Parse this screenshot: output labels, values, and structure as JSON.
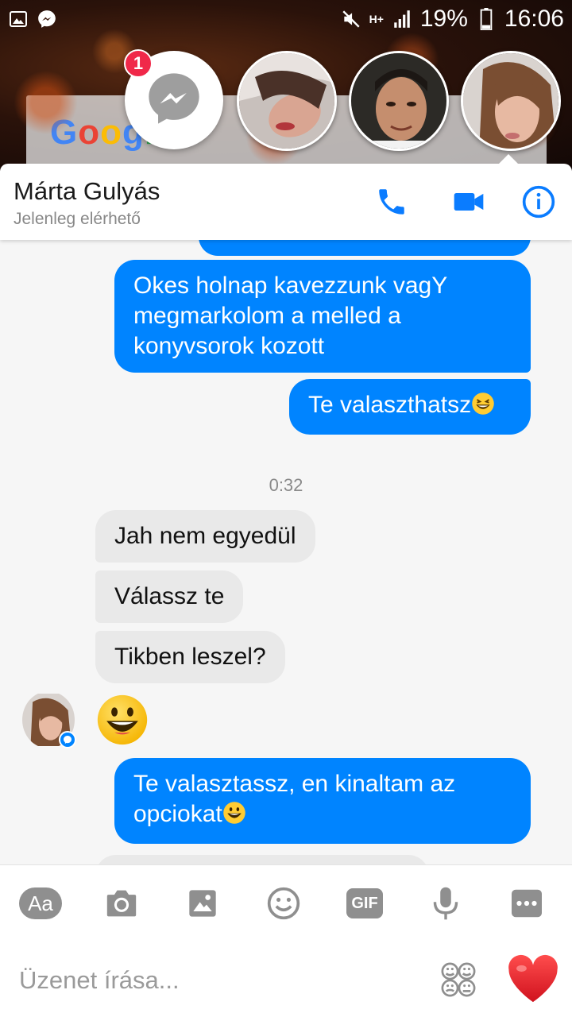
{
  "status_bar": {
    "battery": "19%",
    "time": "16:06",
    "network": "H+"
  },
  "wallpaper": {
    "google_logo": "Google"
  },
  "chat_heads": {
    "messenger_badge": "1"
  },
  "header": {
    "contact_name": "Márta Gulyás",
    "contact_status": "Jelenleg elérhető"
  },
  "messages": [
    {
      "direction": "out",
      "text": "Okes holnap kavezzunk vagY megmarkolom a melled a konyvsorok kozott"
    },
    {
      "direction": "out",
      "text": "Te valaszthatsz",
      "emoji": "grinning-squint-emoji"
    },
    {
      "type": "timestamp",
      "text": "0:32"
    },
    {
      "direction": "in",
      "text": "Jah nem egyedül"
    },
    {
      "direction": "in",
      "text": "Válassz te"
    },
    {
      "direction": "in",
      "text": "Tikben leszel?"
    },
    {
      "direction": "in",
      "emoji": "grinning-emoji"
    },
    {
      "direction": "out",
      "text": "Te valasztassz, en kinaltam az opciokat",
      "emoji": "grinning-emoji"
    }
  ],
  "toolbar": {
    "text_label": "Aa",
    "gif_label": "GIF"
  },
  "composer": {
    "placeholder": "Üzenet írása..."
  },
  "colors": {
    "brand_blue": "#0084ff",
    "header_icon_blue": "#0a7cff",
    "incoming_bubble": "#e9e9e9",
    "badge_red": "#f02849",
    "heart_red": "#e8232f"
  }
}
